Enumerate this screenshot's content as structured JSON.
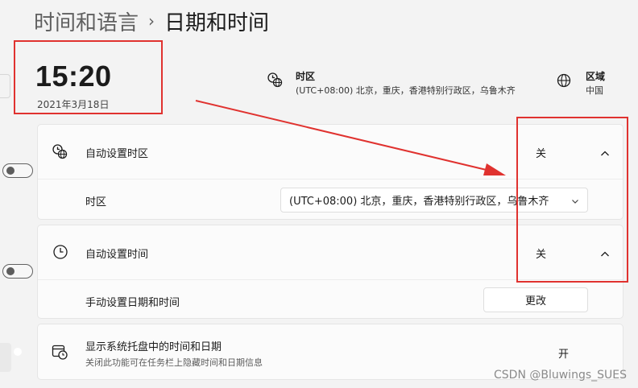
{
  "breadcrumb": {
    "parent": "时间和语言",
    "separator": "›",
    "current": "日期和时间"
  },
  "clock": {
    "time": "15:20",
    "date": "2021年3月18日"
  },
  "info": {
    "timezone": {
      "title": "时区",
      "value": "(UTC+08:00) 北京，重庆，香港特别行政区，乌鲁木齐",
      "icon": "globe-clock-icon"
    },
    "region": {
      "title": "区域",
      "value": "中国",
      "icon": "globe-icon"
    }
  },
  "settings": {
    "auto_timezone": {
      "label": "自动设置时区",
      "state": "关",
      "on": false,
      "icon": "globe-clock-icon"
    },
    "timezone_select": {
      "label": "时区",
      "value": "(UTC+08:00) 北京，重庆，香港特别行政区，乌鲁木齐"
    },
    "auto_time": {
      "label": "自动设置时间",
      "state": "关",
      "on": false,
      "icon": "clock-icon"
    },
    "manual_time": {
      "label": "手动设置日期和时间",
      "button": "更改"
    },
    "tray_time": {
      "label": "显示系统托盘中的时间和日期",
      "sub": "关闭此功能可在任务栏上隐藏时间和日期信息",
      "state": "开",
      "on": true,
      "icon": "calendar-clock-icon"
    }
  },
  "colors": {
    "accent": "#0067c0",
    "annotation": "#e0322f"
  },
  "watermark": "CSDN @Bluwings_SUES"
}
